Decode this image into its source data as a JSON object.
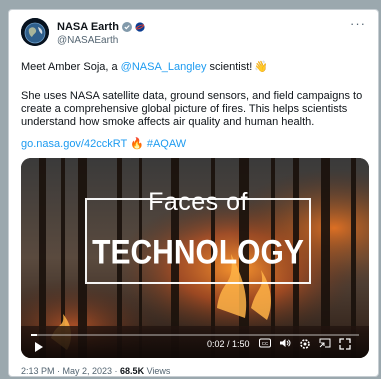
{
  "account": {
    "name": "NASA Earth",
    "handle": "@NASAEarth",
    "verified_color": "#1d9bf0",
    "gov_badge_color": "#829aab"
  },
  "tweet": {
    "line1_prefix": "Meet Amber Soja, a ",
    "mention": "@NASA_Langley",
    "line1_suffix": " scientist!",
    "line1_emoji": "👋",
    "paragraph_lines": [
      "She uses NASA satellite data, ground sensors, and field campaigns to",
      "create a comprehensive global picture of fires. This helps scientists",
      "understand how smoke affects air quality and human health."
    ],
    "link": "go.nasa.gov/42cckRT",
    "fire_emoji": "🔥",
    "hashtag": "#AQAW"
  },
  "video": {
    "title_top": "Faces of",
    "title_bottom": "TECHNOLOGY",
    "time": "0:02 / 1:50",
    "progress": 0.018
  },
  "meta": {
    "datetime": "2:13 PM · May 2, 2023 · ",
    "views": "68.5K",
    "views_label": " Views"
  },
  "icons": {
    "more": "more-icon",
    "play": "play-icon",
    "captions": "captions-icon",
    "volume": "volume-icon",
    "settings": "settings-icon",
    "pip": "pip-icon",
    "fullscreen": "fullscreen-icon"
  }
}
